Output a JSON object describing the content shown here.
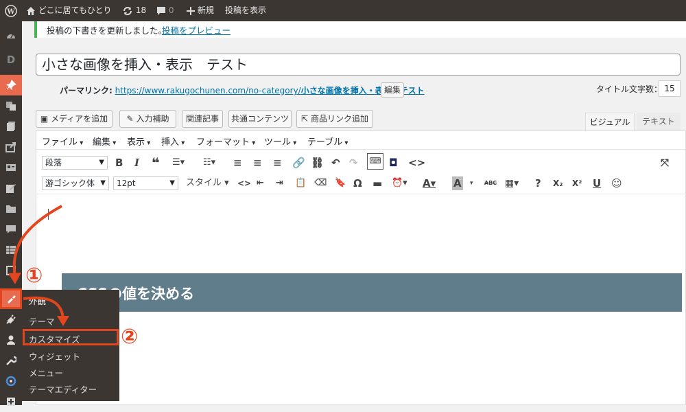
{
  "admin_bar": {
    "site_name": "どこに居てもひとり",
    "updates_count": "18",
    "comments_count": "0",
    "new_label": "新規",
    "view_post_label": "投稿を表示"
  },
  "notice": {
    "message": "投稿の下書きを更新しました。",
    "link": "投稿をプレビュー"
  },
  "post": {
    "title": "小さな画像を挿入・表示　テスト",
    "permalink_label": "パーマリンク:",
    "permalink_url": "https://www.rakugochunen.com/no-category/",
    "permalink_slug": "小さな画像を挿入・表示　テスト",
    "edit_label": "編集",
    "title_count_label": "タイトル文字数：",
    "title_count": "15"
  },
  "media_buttons": {
    "add_media": "メディアを追加",
    "input_help": "入力補助",
    "related": "関連記事",
    "common_content": "共通コンテンツ",
    "product_link": "商品リンク追加"
  },
  "editor_tabs": {
    "visual": "ビジュアル",
    "text": "テキスト"
  },
  "menubar": [
    "ファイル",
    "編集",
    "表示",
    "挿入",
    "フォーマット",
    "ツール",
    "テーブル"
  ],
  "toolbar": {
    "format_select": "段落",
    "font_select": "游ゴシック体",
    "size_select": "12pt",
    "style_label": "スタイル"
  },
  "content": {
    "heading": "CSSの値を決める"
  },
  "flyout": {
    "header": "外観",
    "items": [
      "テーマ",
      "カスタマイズ",
      "ウィジェット",
      "メニュー",
      "テーマエディター"
    ]
  },
  "annotations": {
    "step1": "①",
    "step2": "②"
  },
  "colors": {
    "accent": "#e2461f",
    "heading_bg": "#607d8b",
    "admin_bg": "#3c3632"
  }
}
